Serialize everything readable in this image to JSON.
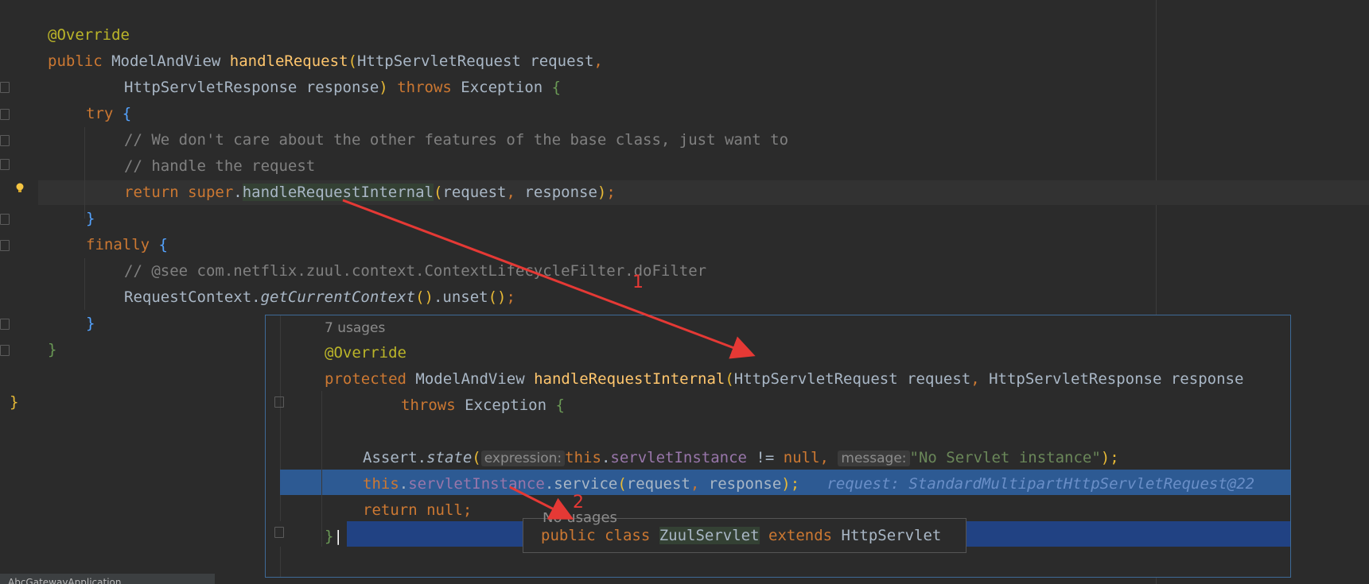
{
  "editor": {
    "annotation": "@Override",
    "sig1": {
      "kw": "public ",
      "type": "ModelAndView ",
      "method": "handleRequest",
      "paren": "(",
      "params": "HttpServletRequest request",
      "comma": ","
    },
    "sig2": {
      "params": "HttpServletResponse response",
      "paren": ")",
      "throws": " throws ",
      "exc": "Exception ",
      "brace": "{"
    },
    "try_kw": "try ",
    "try_brace": "{",
    "comment1": "// We don't care about the other features of the base class, just want to",
    "comment2": "// handle the request",
    "ret": {
      "kw": "return ",
      "super": "super",
      "dot": ".",
      "method": "handleRequestInternal",
      "open": "(",
      "args1": "request",
      "comma": ", ",
      "args2": "response",
      "close": ")",
      "semi": ";"
    },
    "close_try": "}",
    "finally_kw": "finally ",
    "finally_brace": "{",
    "comment3": "// @see com.netflix.zuul.context.ContextLifecycleFilter.doFilter",
    "unset": {
      "cls": "RequestContext.",
      "method": "getCurrentContext",
      "parens": "()",
      "rest": ".unset",
      "call": "()",
      "semi": ";"
    },
    "close_finally": "}",
    "close_method": "}",
    "close_class": "}"
  },
  "popup": {
    "usages": "7 usages",
    "annotation": "@Override",
    "sig": {
      "kw": "protected ",
      "type": "ModelAndView ",
      "method": "handleRequestInternal",
      "paren": "(",
      "p1": "HttpServletRequest request",
      "comma": ", ",
      "p2": "HttpServletResponse response"
    },
    "throws": {
      "kw": "throws ",
      "exc": "Exception ",
      "brace": "{"
    },
    "assert": {
      "cls": "Assert.",
      "method": "state",
      "open": "(",
      "hint1": "expression:",
      "this": "this",
      "dot": ".",
      "field": "servletInstance",
      "op": " != ",
      "null": "null",
      "comma": ", ",
      "hint2": "message:",
      "str": "\"No Servlet instance\"",
      "close": ");"
    },
    "exec": {
      "this": "this",
      "dot": ".",
      "field": "servletInstance",
      "call": ".service",
      "open": "(",
      "a1": "request",
      "comma": ", ",
      "a2": "response",
      "close": ");",
      "inline": "request: StandardMultipartHttpServletRequest@22"
    },
    "ret": {
      "kw": "return ",
      "null": "null",
      "semi": ";"
    },
    "close": "}"
  },
  "tooltip": {
    "usages": "No usages",
    "kw1": "public ",
    "kw2": "class ",
    "name": "ZuulServlet",
    "kw3": " extends ",
    "parent": "HttpServlet"
  },
  "annotations": {
    "n1": "1",
    "n2": "2"
  },
  "bottom_tab": "AbcGatewayApplication"
}
